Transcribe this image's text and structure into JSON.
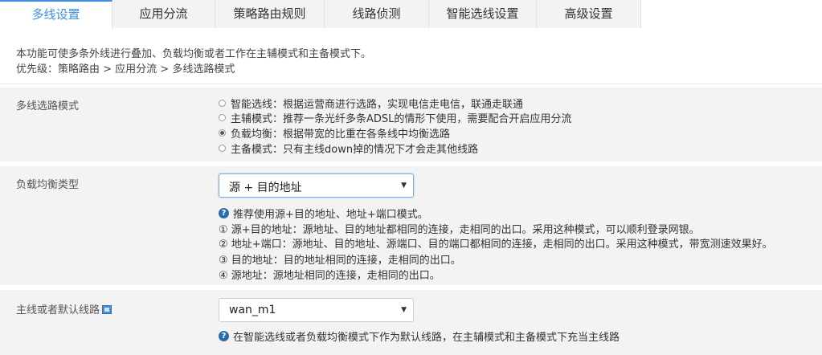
{
  "tabs": [
    {
      "label": "多线设置",
      "active": true
    },
    {
      "label": "应用分流",
      "active": false
    },
    {
      "label": "策略路由规则",
      "active": false
    },
    {
      "label": "线路侦测",
      "active": false
    },
    {
      "label": "智能选线设置",
      "active": false
    },
    {
      "label": "高级设置",
      "active": false
    }
  ],
  "intro": {
    "line1": "本功能可使多条外线进行叠加、负载均衡或者工作在主辅模式和主备模式下。",
    "line2": "优先级：策略路由 > 应用分流 > 多线选路模式"
  },
  "mode_section": {
    "label": "多线选路模式",
    "options": [
      {
        "text": "智能选线：根据运营商进行选路，实现电信走电信，联通走联通",
        "checked": false
      },
      {
        "text": "主辅模式：推荐一条光纤多条ADSL的情形下使用，需要配合开启应用分流",
        "checked": false
      },
      {
        "text": "负载均衡：根据带宽的比重在各条线中均衡选路",
        "checked": true
      },
      {
        "text": "主备模式：只有主线down掉的情况下才会走其他线路",
        "checked": false
      }
    ]
  },
  "lb_section": {
    "label": "负载均衡类型",
    "selected": "源 + 目的地址",
    "help": [
      "推荐使用源+目的地址、地址+端口模式。",
      "① 源+目的地址：源地址、目的地址都相同的连接，走相同的出口。采用这种模式，可以顺利登录网银。",
      "② 地址+端口：源地址、目的地址、源端口、目的端口都相同的连接，走相同的出口。采用这种模式，带宽测速效果好。",
      "③ 目的地址：目的地址相同的连接，走相同的出口。",
      "④ 源地址：源地址相同的连接，走相同的出口。"
    ]
  },
  "default_line_section": {
    "label": "主线或者默认线路",
    "selected": "wan_m1",
    "help": "在智能选线或者负载均衡模式下作为默认线路，在主辅模式和主备模式下充当主线路"
  },
  "icons": {
    "help": "question-circle-icon",
    "info": "info-box-icon",
    "caret": "caret-down-icon"
  },
  "colors": {
    "accent": "#3a8ee6",
    "band": "#f3f3f3",
    "help_icon": "#2b6cb0"
  }
}
